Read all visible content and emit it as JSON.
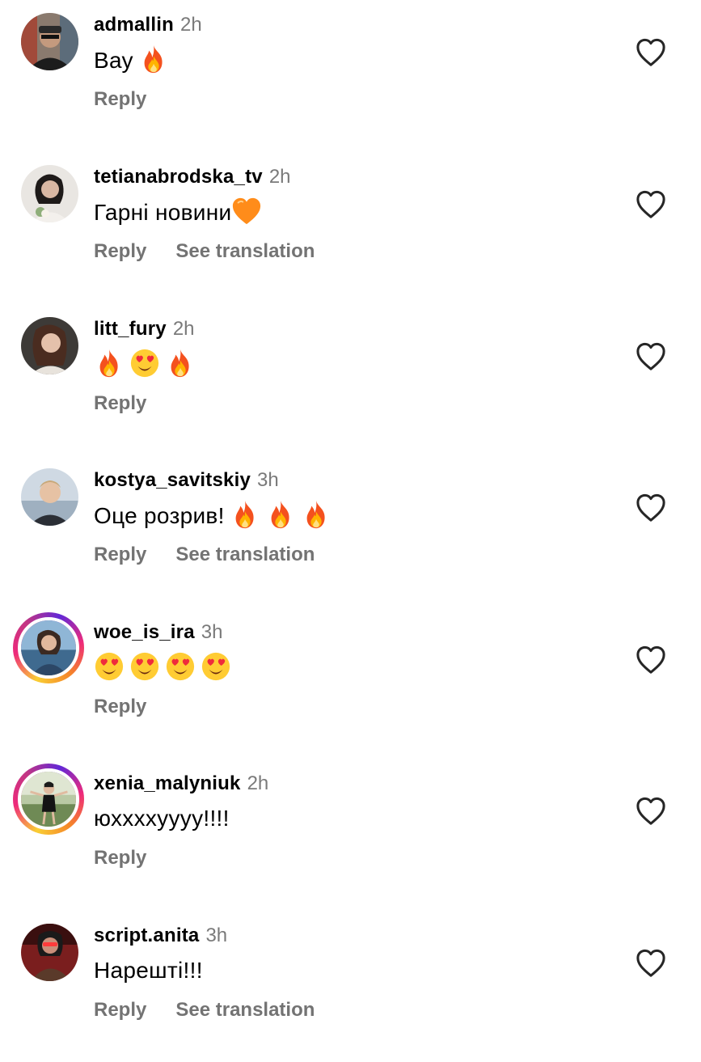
{
  "comments": [
    {
      "username": "admallin",
      "time": "2h",
      "text": "Вау",
      "emojis": [
        "fire"
      ],
      "reply": "Reply",
      "translate": ""
    },
    {
      "username": "tetianabrodska_tv",
      "time": "2h",
      "text": "Гарні новини",
      "emojis": [
        "orange-heart"
      ],
      "reply": "Reply",
      "translate": "See translation"
    },
    {
      "username": "litt_fury",
      "time": "2h",
      "text": "",
      "emojis": [
        "fire",
        "heart-eyes",
        "fire"
      ],
      "reply": "Reply",
      "translate": ""
    },
    {
      "username": "kostya_savitskiy",
      "time": "3h",
      "text": "Оце розрив!",
      "emojis": [
        "fire",
        "fire",
        "fire"
      ],
      "reply": "Reply",
      "translate": "See translation"
    },
    {
      "username": "woe_is_ira",
      "time": "3h",
      "text": "",
      "emojis": [
        "heart-eyes",
        "heart-eyes",
        "heart-eyes",
        "heart-eyes"
      ],
      "reply": "Reply",
      "translate": ""
    },
    {
      "username": "xenia_malyniuk",
      "time": "2h",
      "text": "юххххуууу!!!!",
      "emojis": [],
      "reply": "Reply",
      "translate": ""
    },
    {
      "username": "script.anita",
      "time": "3h",
      "text": "Нарешті!!!",
      "emojis": [],
      "reply": "Reply",
      "translate": "See translation"
    }
  ],
  "colors": {
    "username": "#000000",
    "meta": "#737373",
    "story_ring": [
      "#f9ce34",
      "#ee2a7b",
      "#6228d7"
    ]
  }
}
